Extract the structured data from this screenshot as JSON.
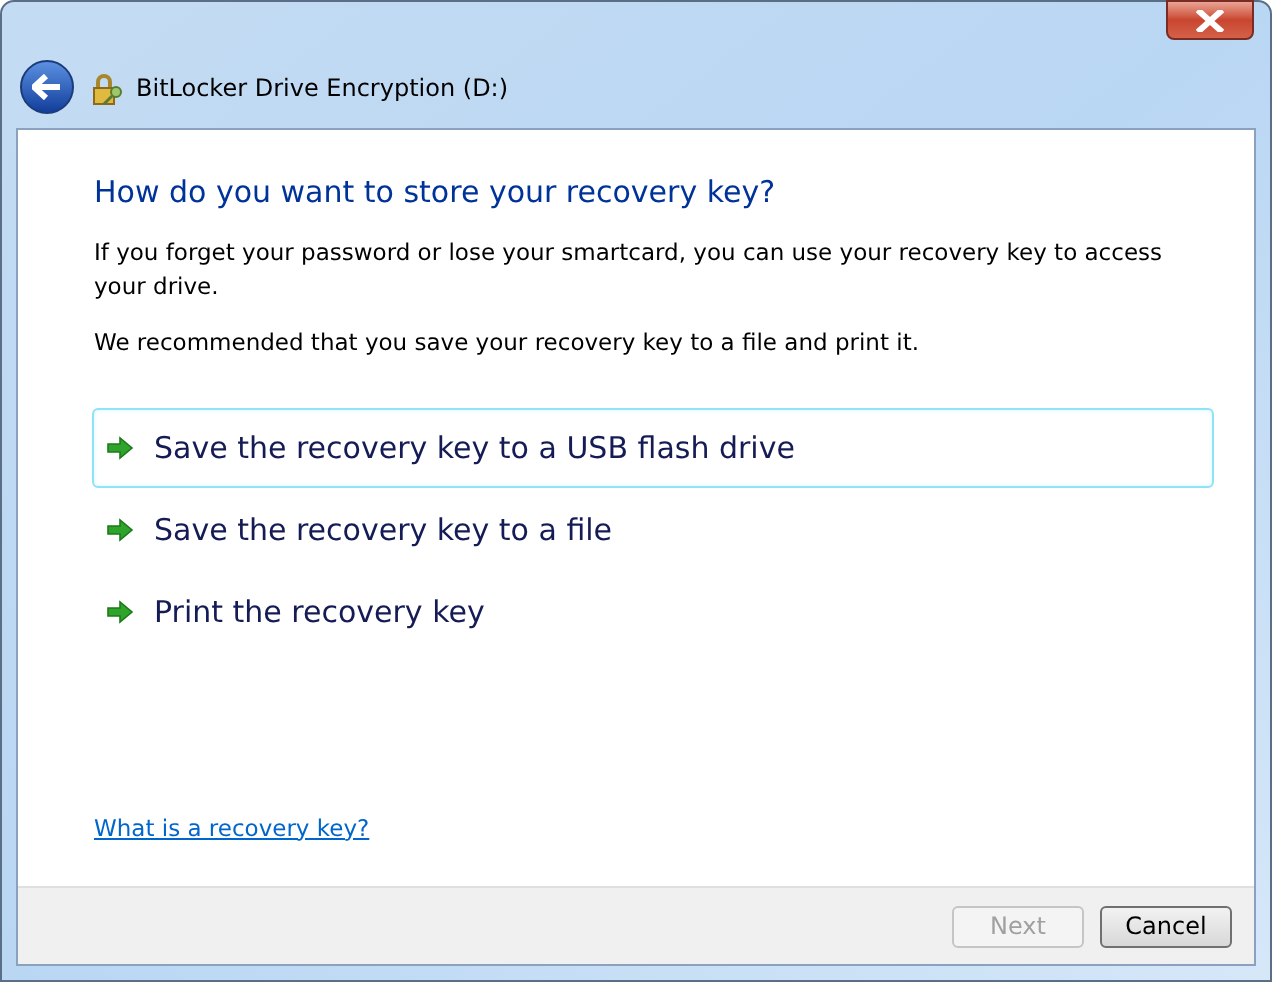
{
  "window": {
    "title": "BitLocker Drive Encryption (D:)"
  },
  "heading": "How do you want to store your recovery key?",
  "paragraphs": [
    "If you forget your password or lose your smartcard, you can use your recovery key to access your drive.",
    "We recommended that you save your recovery key to a file and print it."
  ],
  "options": [
    {
      "label": "Save the recovery key to a USB flash drive",
      "selected": true
    },
    {
      "label": "Save the recovery key to a file",
      "selected": false
    },
    {
      "label": "Print the recovery key",
      "selected": false
    }
  ],
  "help_link": "What is a recovery key?",
  "buttons": [
    {
      "label": "Next",
      "disabled": true
    },
    {
      "label": "Cancel",
      "disabled": false
    }
  ]
}
